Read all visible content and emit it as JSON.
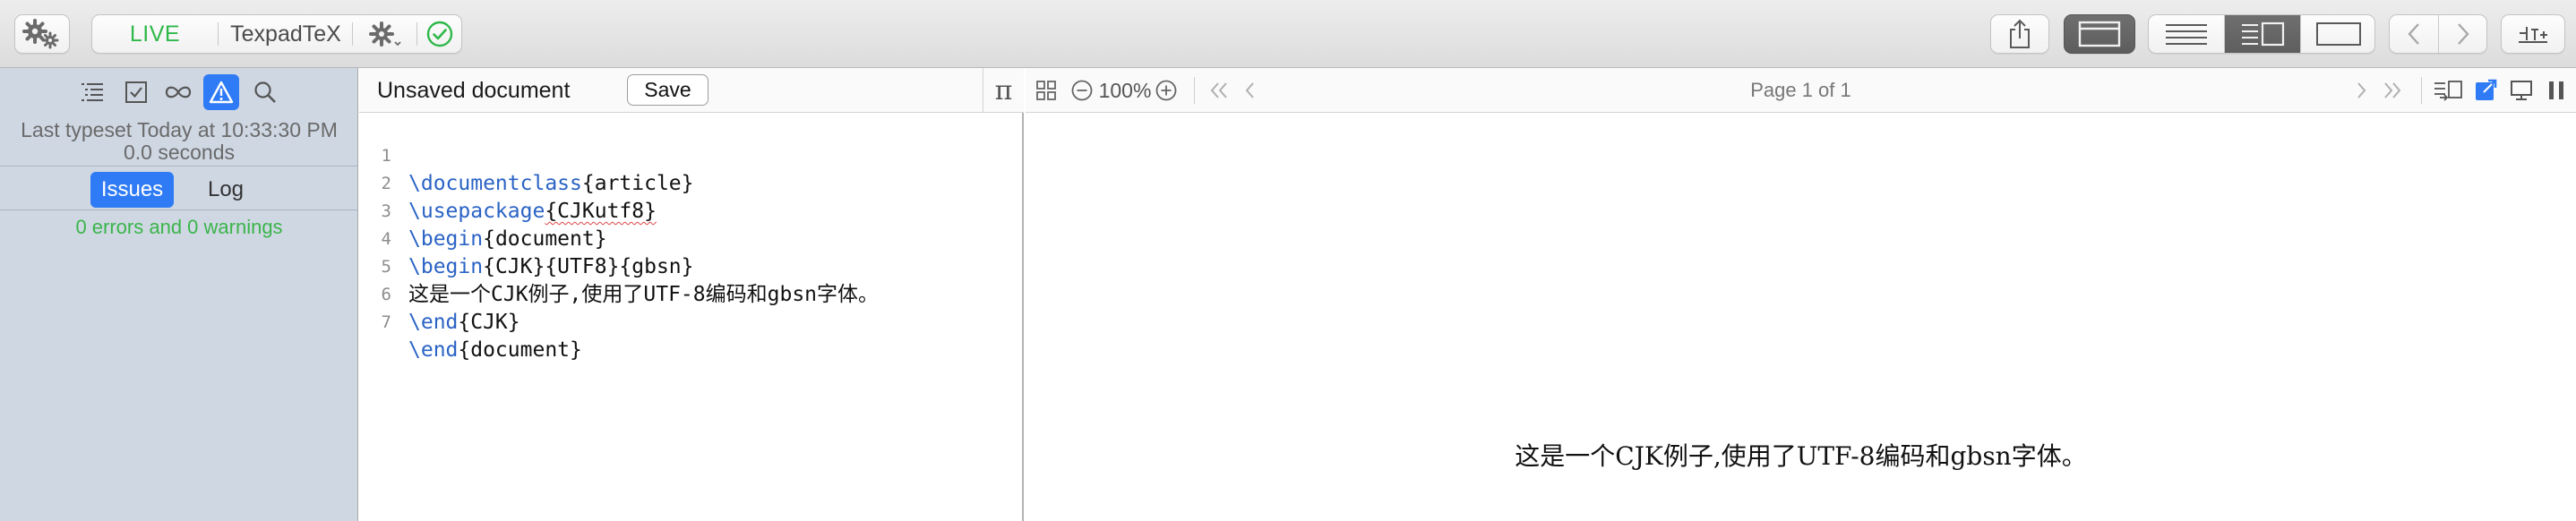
{
  "toolbar": {
    "live_label": "LIVE",
    "engine_label": "TexpadTeX",
    "icons": {
      "settings": "gears-icon",
      "engine_settings": "gear-icon",
      "status": "check-circle-icon",
      "share": "share-icon",
      "window": "window-icon",
      "layout_text": "layout-text-icon",
      "layout_split": "layout-split-icon",
      "layout_preview": "layout-preview-icon",
      "nav_back": "chevron-left-icon",
      "nav_forward": "chevron-right-icon",
      "typeset": "typeset-icon"
    },
    "selected_layout": "split"
  },
  "sidebar": {
    "icons": [
      "outline-icon",
      "checklist-icon",
      "infinity-icon",
      "warning-icon",
      "search-icon"
    ],
    "active_icon": "warning-icon",
    "typeset_status": "Last typeset Today at 10:33:30 PM",
    "typeset_duration": "0.0 seconds",
    "tabs": [
      {
        "label": "Issues",
        "selected": true
      },
      {
        "label": "Log",
        "selected": false
      }
    ],
    "issues_summary": "0 errors and 0 warnings"
  },
  "editor": {
    "document_title": "Unsaved document",
    "save_label": "Save",
    "symbol_label": "π",
    "lines": [
      {
        "number": "1",
        "command": "\\documentclass",
        "arg": "{article}"
      },
      {
        "number": "2",
        "command": "\\usepackage",
        "arg": "{CJKutf8}"
      },
      {
        "number": "3",
        "command": "\\begin",
        "arg": "{document}"
      },
      {
        "number": "4",
        "command": "\\begin",
        "arg": "{CJK}{UTF8}{gbsn}"
      },
      {
        "number": "5",
        "command": "",
        "arg": "这是一个CJK例子,使用了UTF-8编码和gbsn字体。"
      },
      {
        "number": "6",
        "command": "\\end",
        "arg": "{CJK}"
      },
      {
        "number": "7",
        "command": "\\end",
        "arg": "{document}"
      }
    ]
  },
  "preview": {
    "zoom": "100%",
    "page_indicator": "Page 1 of 1",
    "rendered_text": "这是一个CJK例子,使用了UTF-8编码和gbsn字体。"
  },
  "colors": {
    "accent_blue": "#2f7bf5",
    "live_green": "#2fb84a",
    "latex_keyword": "#2a63c5",
    "sidebar_bg": "#cfd7e3"
  }
}
